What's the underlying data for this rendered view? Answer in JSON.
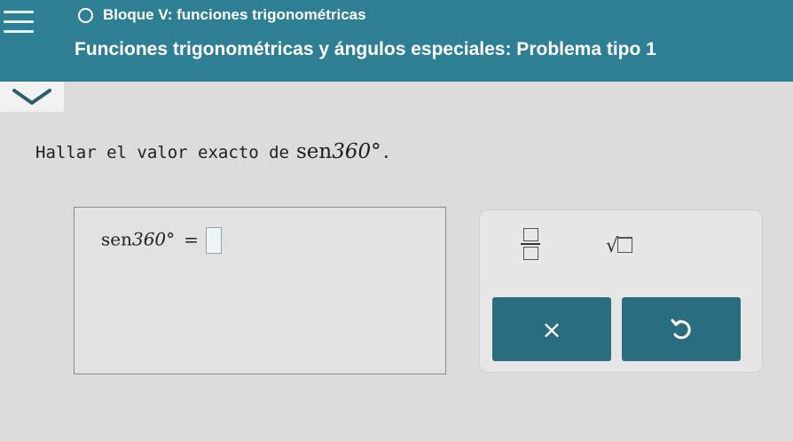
{
  "header": {
    "breadcrumb": "Bloque V: funciones trigonométricas",
    "title": "Funciones trigonométricas y ángulos especiales: Problema tipo 1"
  },
  "question": {
    "prompt": "Hallar el valor exacto de",
    "func": "sen",
    "angle": "360°",
    "end": "."
  },
  "answer": {
    "func": "sen",
    "angle": "360°",
    "equals": "=",
    "value": ""
  },
  "tools": {
    "clear_symbol": "×"
  },
  "colors": {
    "header_bg": "#2f7f94",
    "button_bg": "#2a6d80",
    "page_bg": "#dcdcdc"
  },
  "icons": [
    "menu-icon",
    "circle-icon",
    "chevron-down-icon",
    "fraction-icon",
    "sqrt-icon",
    "close-icon",
    "undo-icon"
  ]
}
